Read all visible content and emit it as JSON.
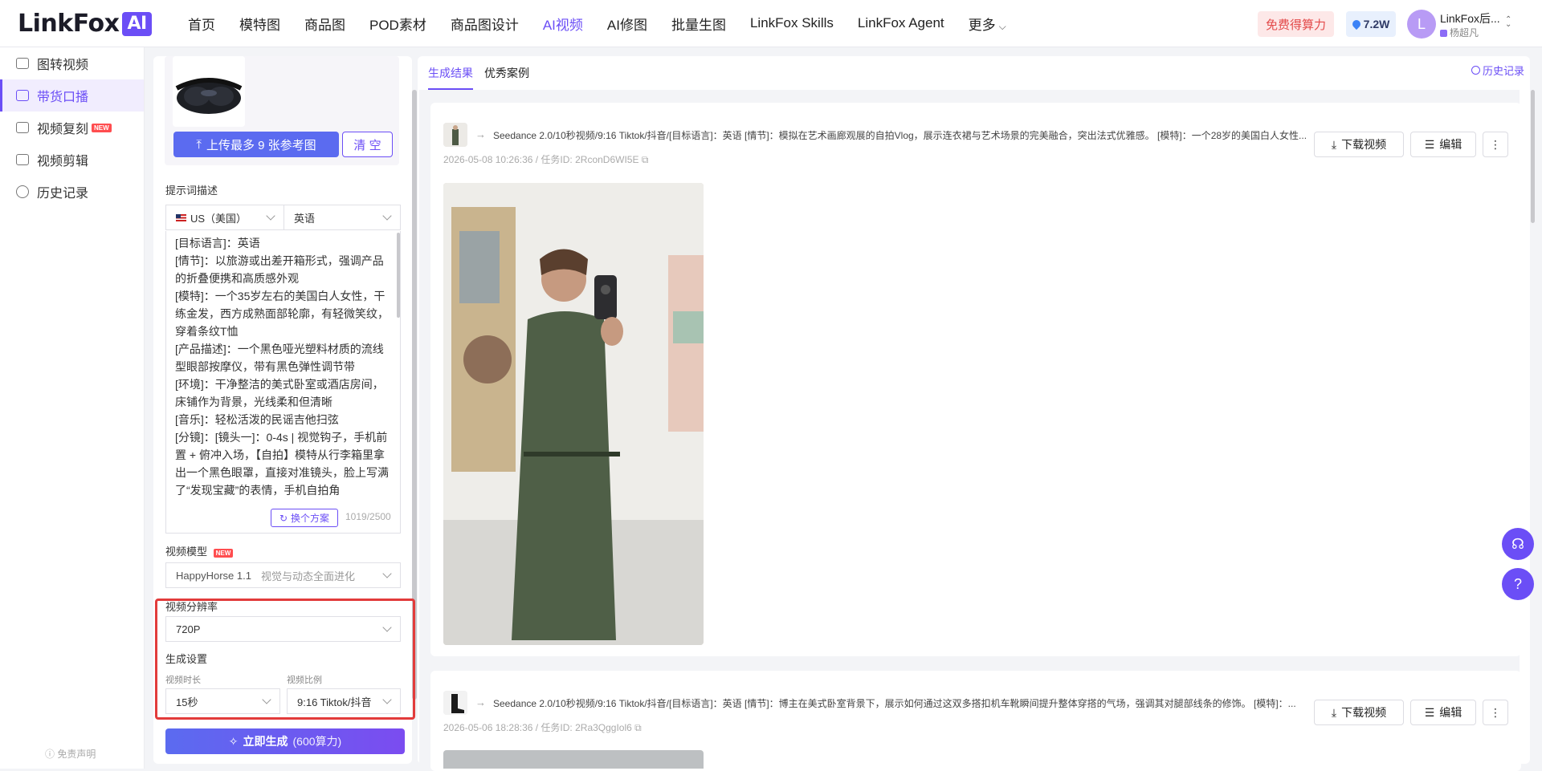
{
  "brand": {
    "name": "LinkFox",
    "ai": "AI"
  },
  "nav": {
    "items": [
      "首页",
      "模特图",
      "商品图",
      "POD素材",
      "商品图设计",
      "AI视频",
      "AI修图",
      "批量生图",
      "LinkFox Skills",
      "LinkFox Agent",
      "更多"
    ],
    "active": "AI视频"
  },
  "header": {
    "free_label": "免费得算力",
    "credits": "7.2W",
    "avatar_letter": "L",
    "user_name": "LinkFox后...",
    "user_sub": "杨超凡"
  },
  "sidebar": {
    "items": [
      {
        "label": "图转视频",
        "new": false
      },
      {
        "label": "带货口播",
        "new": false,
        "active": true
      },
      {
        "label": "视频复刻",
        "new": true
      },
      {
        "label": "视频剪辑",
        "new": false
      },
      {
        "label": "历史记录",
        "new": false
      }
    ],
    "new_tag": "NEW",
    "disclaimer": "免责声明"
  },
  "config": {
    "upload_label": "上传最多 9 张参考图",
    "clear_label": "清 空",
    "prompt_label": "提示词描述",
    "country": "US（美国）",
    "language": "英语",
    "prompt_text": "[目标语言]：英语\n[情节]：以旅游或出差开箱形式，强调产品的折叠便携和高质感外观\n[模特]：一个35岁左右的美国白人女性，干练金发，西方成熟面部轮廓，有轻微笑纹，穿着条纹T恤\n[产品描述]：一个黑色哑光塑料材质的流线型眼部按摩仪，带有黑色弹性调节带\n[环境]：干净整洁的美式卧室或酒店房间，床铺作为背景，光线柔和但清晰\n[音乐]：轻松活泼的民谣吉他扫弦\n[分镜]：[镜头一]：0-4s | 视觉钩子，手机前置 + 俯冲入场，【自拍】模特从行李箱里拿出一个黑色眼罩，直接对准镜头，脸上写满了“发现宝藏”的表情，手机自拍角",
    "switch_label": "换个方案",
    "counter": "1019/2500",
    "model_label": "视频模型",
    "model_new": "NEW",
    "model_value": "HappyHorse 1.1",
    "model_sub": "视觉与动态全面进化",
    "resolution_label": "视频分辨率",
    "resolution_value": "720P",
    "gen_settings_label": "生成设置",
    "duration_label": "视频时长",
    "duration_value": "15秒",
    "ratio_label": "视频比例",
    "ratio_value": "9:16 Tiktok/抖音",
    "generate_label": "立即生成",
    "generate_cost": "(600算力)"
  },
  "results": {
    "tabs": [
      "生成结果",
      "优秀案例"
    ],
    "history_label": "历史记录",
    "download_label": "下载视频",
    "edit_label": "编辑",
    "cards": [
      {
        "title": "Seedance 2.0/10秒视频/9:16 Tiktok/抖音/[目标语言]：英语 [情节]：模拟在艺术画廊观展的自拍Vlog，展示连衣裙与艺术场景的完美融合，突出法式优雅感。 [模特]：一个28岁的美国白人女性...",
        "meta": "2026-05-08 10:26:36 / 任务ID: 2RconD6WI5E"
      },
      {
        "title": "Seedance 2.0/10秒视频/9:16 Tiktok/抖音/[目标语言]：英语 [情节]：博主在美式卧室背景下，展示如何通过这双多搭扣机车靴瞬间提升整体穿搭的气场，强调其对腿部线条的修饰。 [模特]：...",
        "meta": "2026-05-06 18:28:36 / 任务ID: 2Ra3QggIol6"
      }
    ]
  },
  "colors": {
    "accent": "#6b4ef6",
    "highlight": "#e23b3b"
  }
}
